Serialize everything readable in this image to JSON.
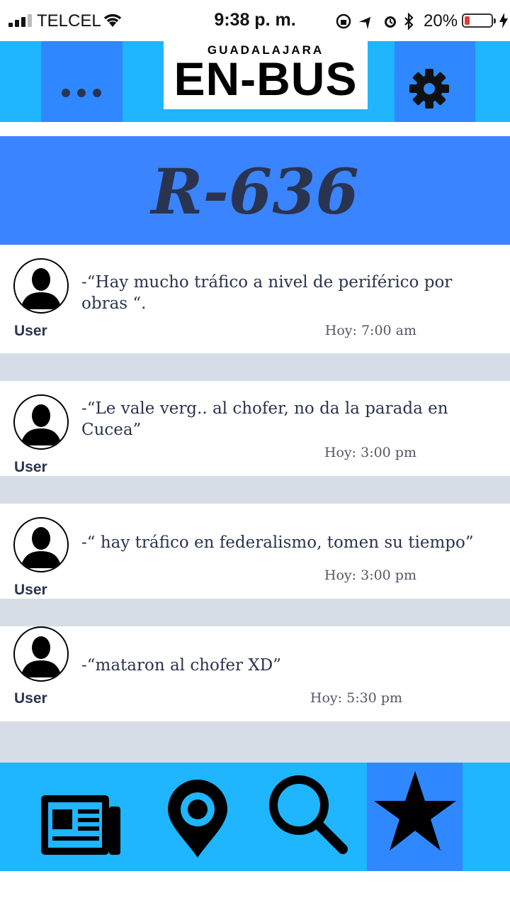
{
  "status_bar": {
    "carrier": "TELCEL",
    "time": "9:38 p. m.",
    "battery_percent": "20%",
    "battery_level": 0.2
  },
  "header": {
    "city": "GUADALAJARA",
    "app_name": "EN-BUS",
    "menu_icon": "more-dots-icon",
    "settings_icon": "gear-icon"
  },
  "route": {
    "code": "R-636"
  },
  "posts": [
    {
      "text": "-“Hay mucho tráfico a nivel de periférico por obras “.",
      "user": "User",
      "time": "Hoy: 7:00 am"
    },
    {
      "text": "-“Le vale verg.. al chofer, no da la parada en Cucea”",
      "user": "User",
      "time": "Hoy: 3:00 pm"
    },
    {
      "text": "-“ hay tráfico en federalismo, tomen su tiempo”",
      "user": "User",
      "time": "Hoy: 3:00 pm"
    },
    {
      "text": "-“mataron al chofer XD”",
      "user": "User",
      "time": "Hoy: 5:30 pm"
    }
  ],
  "bottom_nav": {
    "items": [
      {
        "icon": "newspaper-icon",
        "active": false
      },
      {
        "icon": "map-pin-icon",
        "active": false
      },
      {
        "icon": "search-icon",
        "active": false
      },
      {
        "icon": "star-icon",
        "active": true
      }
    ]
  },
  "colors": {
    "header_bg": "#1fb5ff",
    "accent": "#2f88ff",
    "route_bg": "#3a84ff",
    "text_dark": "#2a3450",
    "separator": "#d6dde6"
  }
}
